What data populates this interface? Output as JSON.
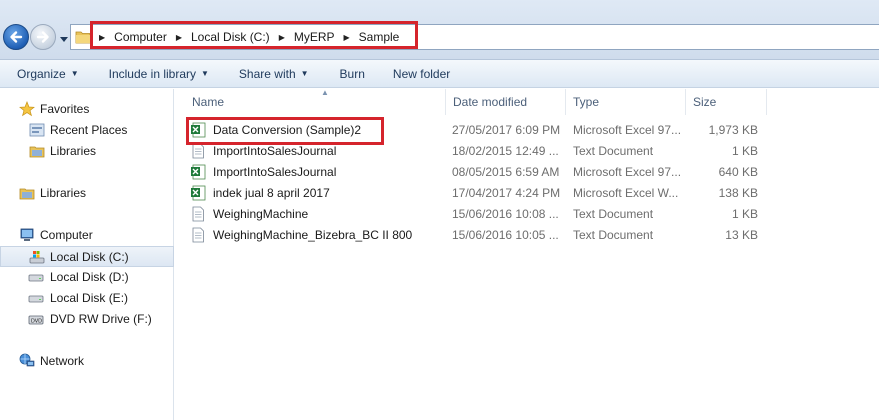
{
  "breadcrumb": [
    "Computer",
    "Local Disk (C:)",
    "MyERP",
    "Sample"
  ],
  "toolbar": {
    "organize": "Organize",
    "include_in_library": "Include in library",
    "share_with": "Share with",
    "burn": "Burn",
    "new_folder": "New folder"
  },
  "sidebar": {
    "favorites": "Favorites",
    "recent_places": "Recent Places",
    "fav_libraries": "Libraries",
    "libraries": "Libraries",
    "computer": "Computer",
    "local_c": "Local Disk (C:)",
    "local_d": "Local Disk (D:)",
    "local_e": "Local Disk (E:)",
    "dvd": "DVD RW Drive (F:)",
    "network": "Network"
  },
  "columns": {
    "name": "Name",
    "date": "Date modified",
    "type": "Type",
    "size": "Size"
  },
  "files": [
    {
      "name": "Data Conversion (Sample)2",
      "date": "27/05/2017 6:09 PM",
      "type": "Microsoft Excel 97...",
      "size": "1,973 KB",
      "icon": "excel-icon"
    },
    {
      "name": "ImportIntoSalesJournal",
      "date": "18/02/2015 12:49 ...",
      "type": "Text Document",
      "size": "1 KB",
      "icon": "text-document-icon"
    },
    {
      "name": "ImportIntoSalesJournal",
      "date": "08/05/2015 6:59 AM",
      "type": "Microsoft Excel 97...",
      "size": "640 KB",
      "icon": "excel-icon"
    },
    {
      "name": "indek jual 8 april 2017",
      "date": "17/04/2017 4:24 PM",
      "type": "Microsoft Excel W...",
      "size": "138 KB",
      "icon": "excel-icon"
    },
    {
      "name": "WeighingMachine",
      "date": "15/06/2016 10:08 ...",
      "type": "Text Document",
      "size": "1 KB",
      "icon": "text-document-icon"
    },
    {
      "name": "WeighingMachine_Bizebra_BC II 800",
      "date": "15/06/2016 10:05 ...",
      "type": "Text Document",
      "size": "13 KB",
      "icon": "text-document-icon"
    }
  ],
  "colors": {
    "highlight": "#d5242c",
    "toolbar_text": "#1e395b",
    "secondary_text": "#6d6d6d"
  }
}
